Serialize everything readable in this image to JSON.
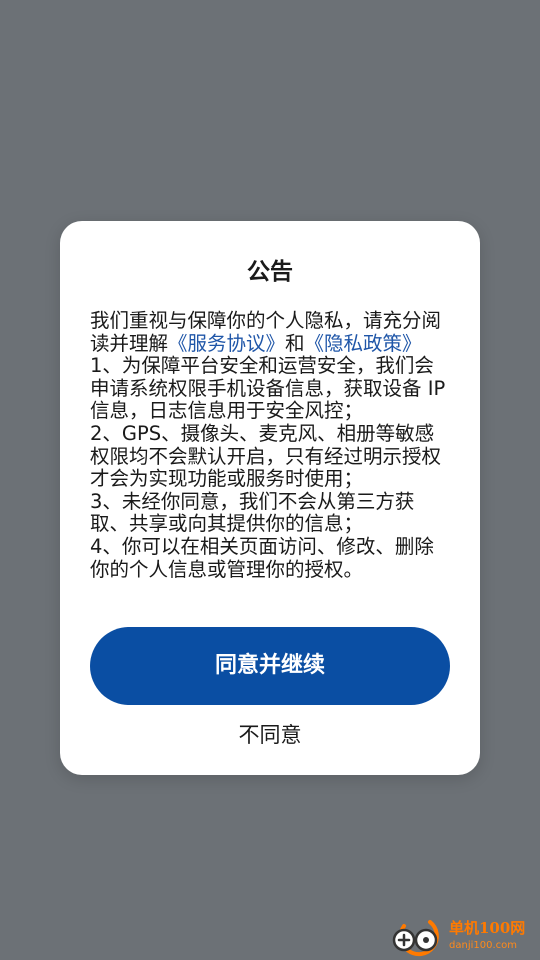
{
  "dialog": {
    "title": "公告",
    "intro_text": "我们重视与保障你的个人隐私，请充分阅读并理解",
    "service_link": "《服务协议》",
    "and_text": "和",
    "privacy_link": "《隐私政策》",
    "items": [
      "1、为保障平台安全和运营安全，我们会申请系统权限手机设备信息，获取设备 IP 信息，日志信息用于安全风控；",
      "2、GPS、摄像头、麦克风、相册等敏感权限均不会默认开启，只有经过明示授权才会为实现功能或服务时使用；",
      "3、未经你同意，我们不会从第三方获取、共享或向其提供你的信息；",
      "4、你可以在相关页面访问、修改、删除你的个人信息或管理你的授权。"
    ],
    "agree_label": "同意并继续",
    "disagree_label": "不同意"
  },
  "watermark": {
    "name": "单机100网",
    "domain": "danji100.com",
    "icon": "gamepad-logo-icon"
  },
  "colors": {
    "overlay": "#6c7176",
    "dialog_bg": "#ffffff",
    "primary": "#0a4ea3",
    "link": "#1f56a8",
    "watermark": "#ff7a00"
  }
}
